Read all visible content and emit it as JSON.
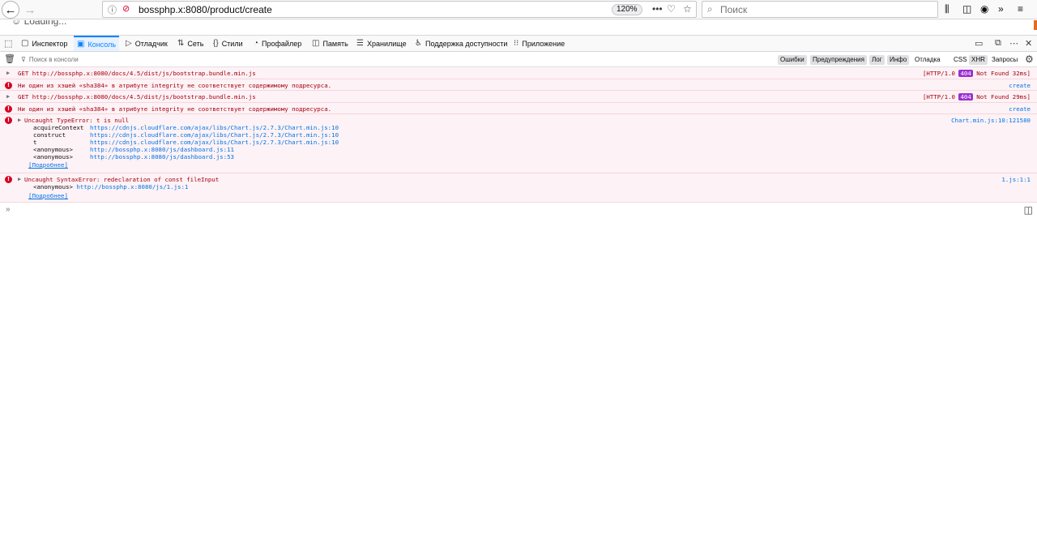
{
  "browser": {
    "url": "bossphp.x:8080/product/create",
    "zoom": "120%",
    "search_placeholder": "Поиск",
    "page_fragment": "☺ Loading..."
  },
  "devtools": {
    "tabs": [
      {
        "label": "Инспектор",
        "icon": "inspector-icon",
        "glyph": "▢"
      },
      {
        "label": "Консоль",
        "icon": "console-icon",
        "glyph": "▣"
      },
      {
        "label": "Отладчик",
        "icon": "debugger-icon",
        "glyph": "▷"
      },
      {
        "label": "Сеть",
        "icon": "network-icon",
        "glyph": "⇅"
      },
      {
        "label": "Стили",
        "icon": "style-editor-icon",
        "glyph": "{}"
      },
      {
        "label": "Профайлер",
        "icon": "performance-icon",
        "glyph": "◔"
      },
      {
        "label": "Память",
        "icon": "memory-icon",
        "glyph": "◫"
      },
      {
        "label": "Хранилище",
        "icon": "storage-icon",
        "glyph": "☰"
      },
      {
        "label": "Поддержка доступности",
        "icon": "accessibility-icon",
        "glyph": "♿"
      },
      {
        "label": "Приложение",
        "icon": "application-icon",
        "glyph": "⁝⁝"
      }
    ],
    "filter_placeholder": "Поиск в консоли",
    "filters": {
      "errors": "Ошибки",
      "warnings": "Предупреждения",
      "log": "Лог",
      "info": "Инфо",
      "debug": "Отладка",
      "css": "CSS",
      "xhr": "XHR",
      "requests": "Запросы"
    }
  },
  "console": {
    "messages": [
      {
        "text": "GET http://bossphp.x:8080/docs/4.5/dist/js/bootstrap.bundle.min.js",
        "status_pre": "[HTTP/1.0 ",
        "status_code": "404",
        "status_post": " Not Found 32ms]"
      },
      {
        "text": "Ни один из хэшей «sha384» в атрибуте integrity не соответствует содержимому подресурса.",
        "source": "create"
      },
      {
        "text": "GET http://bossphp.x:8080/docs/4.5/dist/js/bootstrap.bundle.min.js",
        "status_pre": "[HTTP/1.0 ",
        "status_code": "404",
        "status_post": " Not Found 29ms]"
      },
      {
        "text": "Ни один из хэшей «sha384» в атрибуте integrity не соответствует содержимому подресурса.",
        "source": "create"
      },
      {
        "text": "Uncaught TypeError: t is null",
        "source": "Chart.min.js:10:121580",
        "stack": [
          {
            "fn": "acquireContext",
            "link": "https://cdnjs.cloudflare.com/ajax/libs/Chart.js/2.7.3/Chart.min.js:10"
          },
          {
            "fn": "construct",
            "link": "https://cdnjs.cloudflare.com/ajax/libs/Chart.js/2.7.3/Chart.min.js:10"
          },
          {
            "fn": "t",
            "link": "https://cdnjs.cloudflare.com/ajax/libs/Chart.js/2.7.3/Chart.min.js:10"
          },
          {
            "fn": "<anonymous>",
            "link": "http://bossphp.x:8080/js/dashboard.js:11"
          },
          {
            "fn": "<anonymous>",
            "link": "http://bossphp.x:8080/js/dashboard.js:53"
          }
        ],
        "more": "[Подробнее]"
      },
      {
        "text": "Uncaught SyntaxError: redeclaration of const fileInput",
        "source": "1.js:1:1",
        "stack_fn": "<anonymous>",
        "stack_link": "http://bossphp.x:8080/js/1.js:1",
        "more": "[Подробнее]"
      }
    ]
  }
}
